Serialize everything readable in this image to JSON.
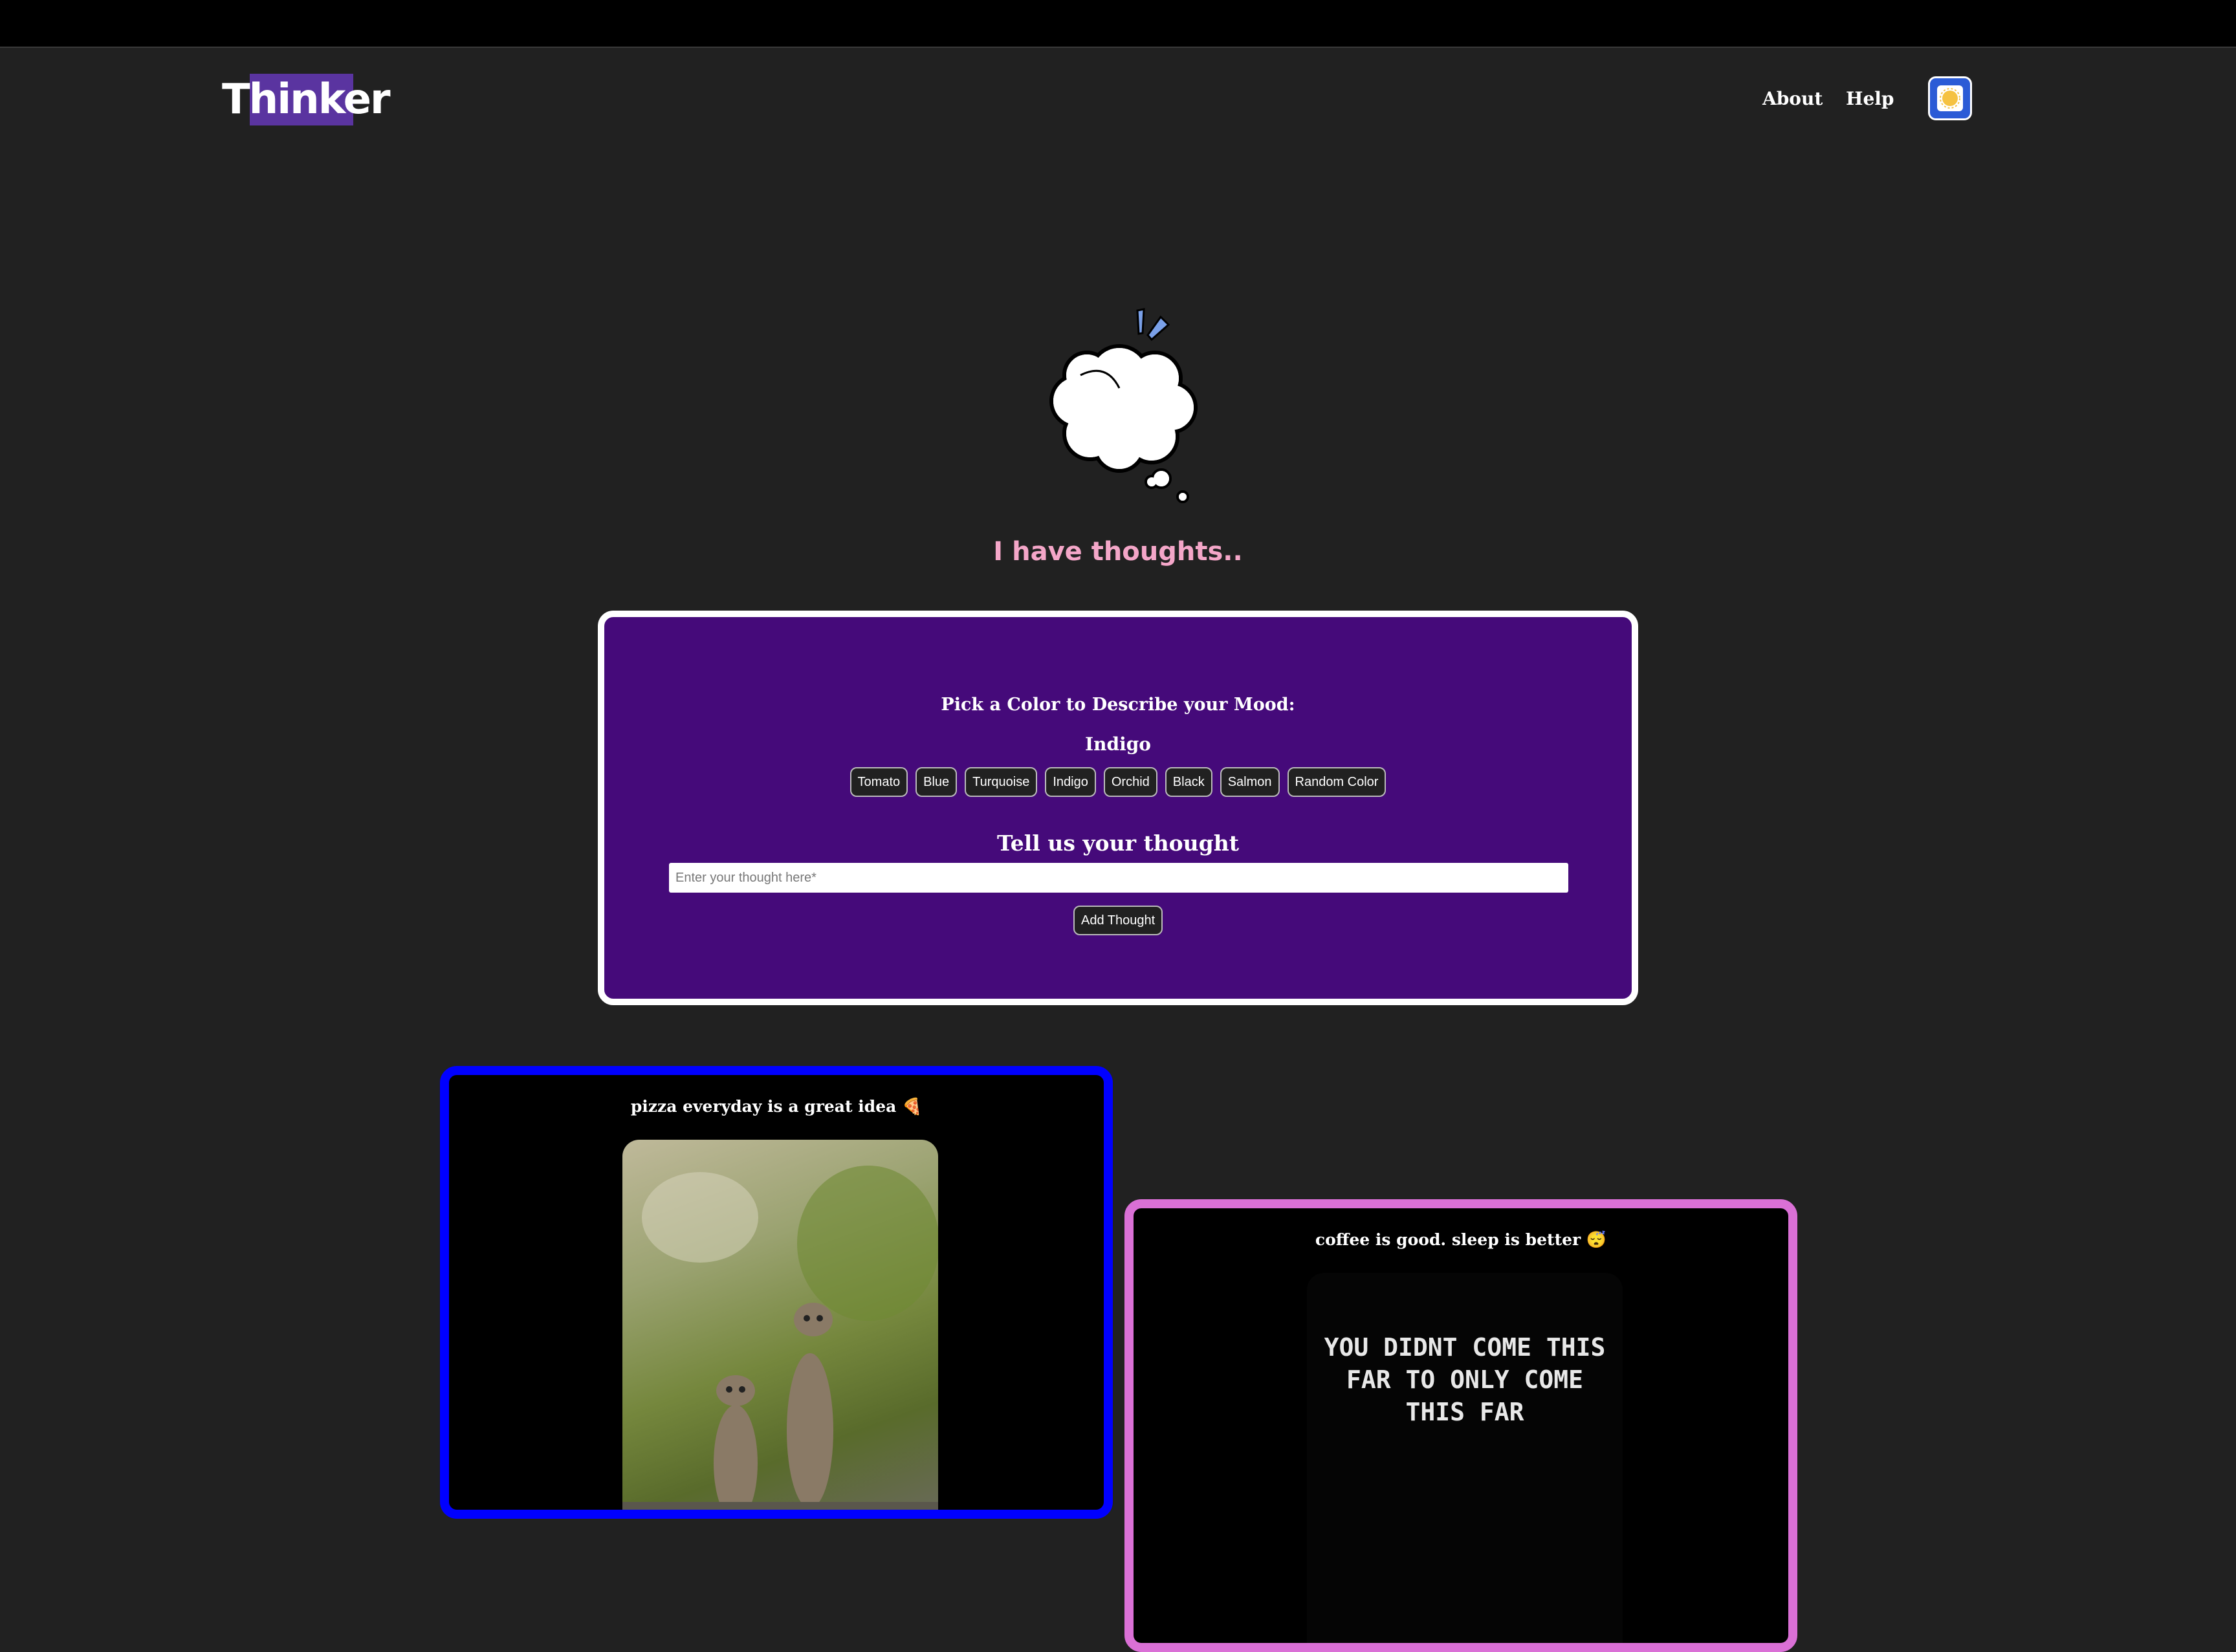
{
  "header": {
    "logo": "Thinker",
    "nav": {
      "about": "About",
      "help": "Help"
    },
    "theme_toggle_icon": "sun-icon"
  },
  "hero": {
    "image_icon": "thought-cloud-icon",
    "title": "I have thoughts.."
  },
  "form": {
    "mood_label": "Pick a Color to Describe your Mood:",
    "selected_color": "Indigo",
    "colors": [
      "Tomato",
      "Blue",
      "Turquoise",
      "Indigo",
      "Orchid",
      "Black",
      "Salmon",
      "Random Color"
    ],
    "thought_label": "Tell us your thought",
    "input": {
      "placeholder": "Enter your thought here*",
      "value": ""
    },
    "add_button": "Add Thought",
    "card_color": "#450a7a"
  },
  "thoughts": [
    {
      "text": "pizza everyday is a great idea 🍕",
      "border_color": "#0000ff",
      "image": "meerkats-photo"
    },
    {
      "text": "coffee is good. sleep is better 😴",
      "border_color": "#da70d6",
      "image": "motivational-meme",
      "image_text": "YOU DIDNT COME THIS\nFAR TO ONLY COME\nTHIS FAR"
    }
  ]
}
